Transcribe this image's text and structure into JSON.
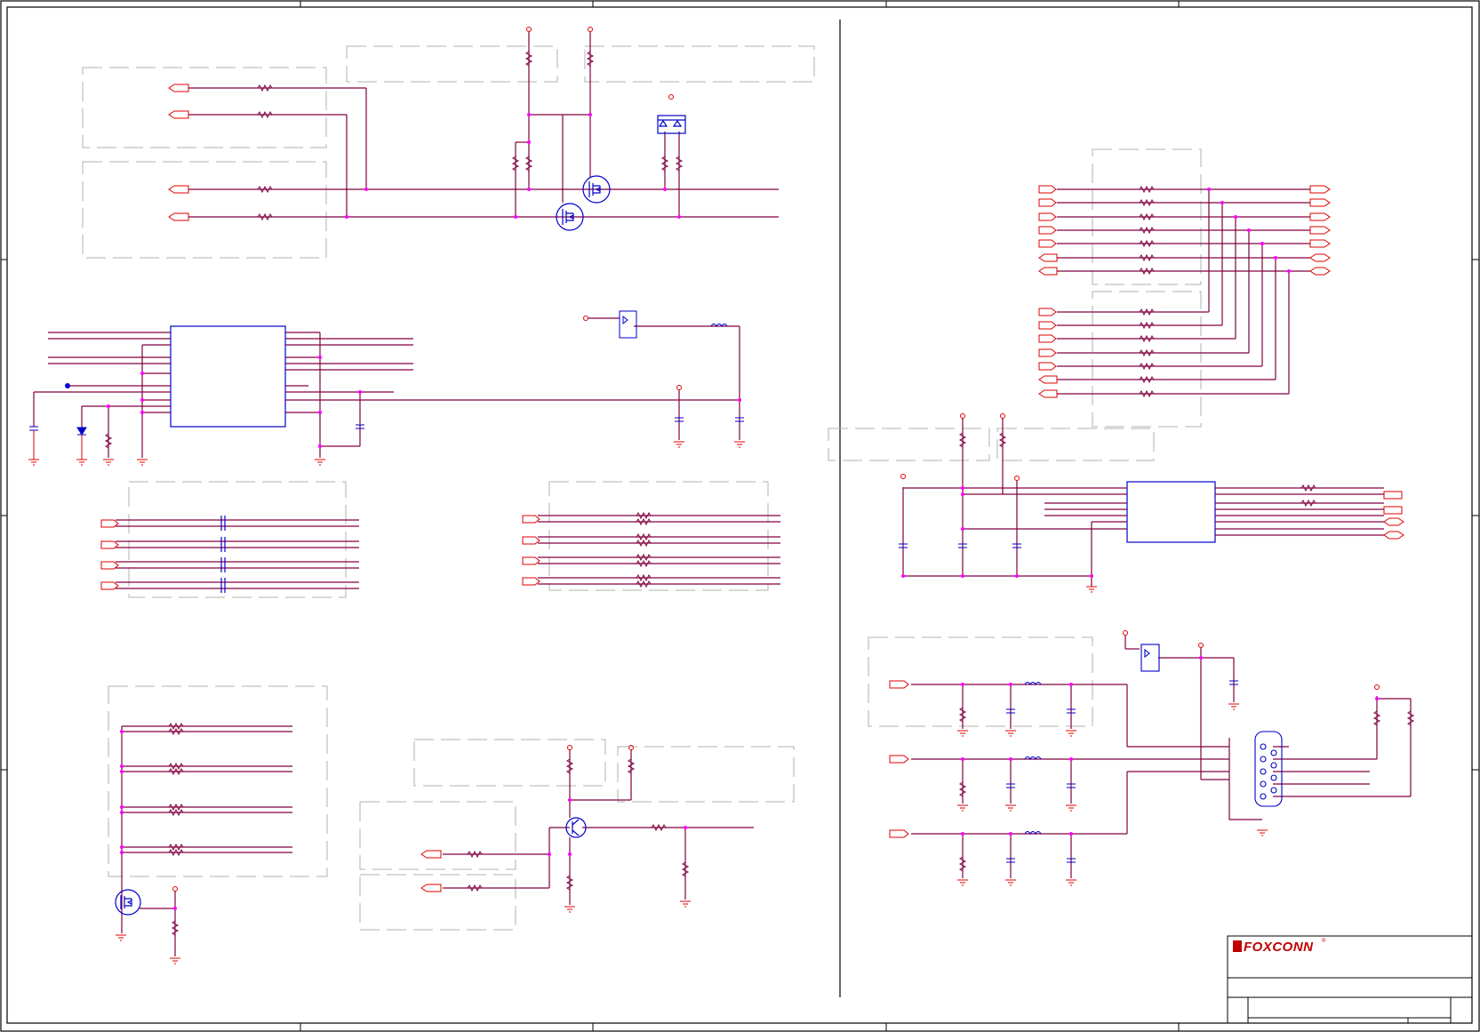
{
  "title_block": {
    "company_logo": "FOXCONN",
    "registered_mark": "®",
    "brand_color": "#c00000"
  },
  "colors": {
    "net_wire": "#800040",
    "power_flag": "#e00000",
    "component_body": "#0000cc",
    "junction_dot": "#ff00ff",
    "frame": "#000000",
    "dashed_group_box": "#a0a0a0"
  },
  "icons": {
    "mosfet": "mosfet-icon",
    "resistor": "resistor-icon",
    "capacitor": "capacitor-icon",
    "ground": "ground-icon",
    "ferrite_bead": "ferrite-bead-icon",
    "diode_pair": "diode-array-icon",
    "npn_transistor": "npn-transistor-icon",
    "db15_connector": "vga-connector-icon"
  }
}
